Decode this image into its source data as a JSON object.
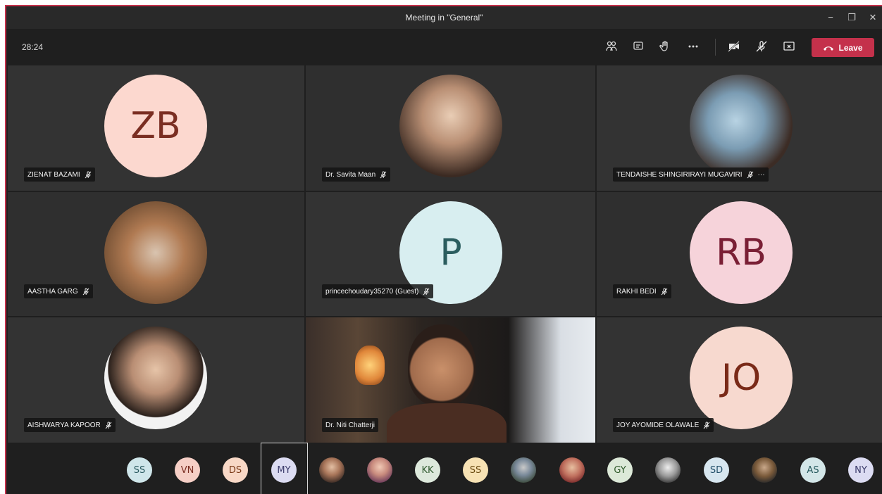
{
  "window": {
    "title": "Meeting in \"General\"",
    "controls": {
      "minimize": "−",
      "restore": "❐",
      "close": "✕"
    }
  },
  "toolbar": {
    "timer": "28:24",
    "icons": [
      "participants-icon",
      "chat-icon",
      "raise-hand-icon",
      "more-options-icon",
      "camera-off-icon",
      "mic-off-icon",
      "share-tray-icon"
    ],
    "leave_label": "Leave",
    "leave_color": "#c4314b"
  },
  "tiles": [
    {
      "name": "ZIENAT BAZAMI",
      "initials": "ZB",
      "bg": "#fcd8cf",
      "fg": "#7a2e22",
      "type": "initials"
    },
    {
      "name": "Dr. Savita Maan",
      "initials": "",
      "type": "photo"
    },
    {
      "name": "TENDAISHE SHINGIRIRAYI MUGAVIRI",
      "initials": "",
      "type": "photo",
      "more": "···"
    },
    {
      "name": "AASTHA GARG",
      "initials": "",
      "type": "photo"
    },
    {
      "name": "princechoudary35270 (Guest)",
      "initials": "P",
      "bg": "#d8eef0",
      "fg": "#2b5d5f",
      "type": "initials"
    },
    {
      "name": "RAKHI BEDI",
      "initials": "RB",
      "bg": "#f6d3da",
      "fg": "#7a1f35",
      "type": "initials"
    },
    {
      "name": "AISHWARYA KAPOOR",
      "initials": "",
      "type": "photo"
    },
    {
      "name": "Dr. Niti Chatterji",
      "initials": "",
      "type": "video"
    },
    {
      "name": "JOY AYOMIDE OLAWALE",
      "initials": "JO",
      "bg": "#f7d9cf",
      "fg": "#7a2a18",
      "type": "initials"
    }
  ],
  "strip": [
    {
      "initials": "SS",
      "bg": "#cfe6ea",
      "fg": "#2a5a60"
    },
    {
      "initials": "VN",
      "bg": "#f6cfc6",
      "fg": "#7a2e22"
    },
    {
      "initials": "DS",
      "bg": "#f8d8c6",
      "fg": "#7a3a18"
    },
    {
      "initials": "MY",
      "bg": "#dcdcf2",
      "fg": "#3b3b6a",
      "selected": true
    },
    {
      "initials": "",
      "image": true
    },
    {
      "initials": "",
      "image": true
    },
    {
      "initials": "KK",
      "bg": "#dde9dc",
      "fg": "#2f5a2e"
    },
    {
      "initials": "SS",
      "bg": "#f7e2b4",
      "fg": "#6a4a10"
    },
    {
      "initials": "",
      "image": true
    },
    {
      "initials": "",
      "image": true
    },
    {
      "initials": "GY",
      "bg": "#dce9d8",
      "fg": "#2f5a2a"
    },
    {
      "initials": "",
      "image": true
    },
    {
      "initials": "SD",
      "bg": "#d7e6ef",
      "fg": "#24506a"
    },
    {
      "initials": "",
      "image": true
    },
    {
      "initials": "AS",
      "bg": "#d3e6e8",
      "fg": "#24585c"
    },
    {
      "initials": "NY",
      "bg": "#dcdcf2",
      "fg": "#3b3b6a"
    }
  ]
}
